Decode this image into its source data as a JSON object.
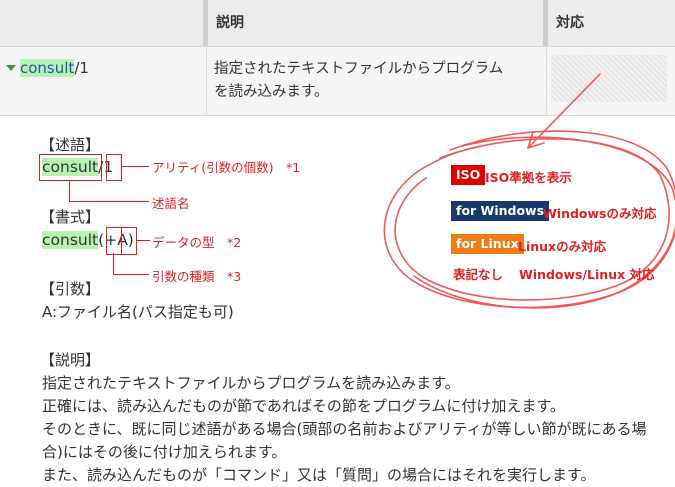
{
  "table": {
    "header_desc": "説明",
    "header_support": "対応",
    "row": {
      "predicate_name": "consult",
      "predicate_arity": "/1",
      "description_line1": "指定されたテキストファイルからプログラム",
      "description_line2": "を読み込みます。"
    }
  },
  "detail": {
    "predicate_heading": "【述語】",
    "predicate_name": "consult",
    "predicate_slash": "/",
    "predicate_arity": "1",
    "arity_note": "アリティ(引数の個数)　*1",
    "name_note": "述語名",
    "format_heading": "【書式】",
    "format_name": "consult",
    "format_open": "(",
    "format_type": "+",
    "format_arg": "A",
    "format_close": ")",
    "type_note": "データの型　*2",
    "kind_note": "引数の種類　*3",
    "args_heading": "【引数】",
    "args_text": "A:ファイル名(パス指定も可)",
    "desc_heading": "【説明】",
    "desc_lines": [
      "指定されたテキストファイルからプログラムを読み込みます。",
      "正確には、読み込んだものが節であればその節をプログラムに付け加えます。",
      "そのときに、既に同じ述語がある場合(頭部の名前およびアリティが等しい節が既にある場",
      "合)にはその後に付け加えられます。",
      "また、読み込んだものが「コマンド」又は「質問」の場合にはそれを実行します。"
    ]
  },
  "legend": {
    "iso_badge": "ISO",
    "iso_text": "ISO準拠を表示",
    "windows_badge": "for Windows",
    "windows_text": "Windowsのみ対応",
    "linux_badge": "for Linux",
    "linux_text": "Linuxのみ対応",
    "none_label": "表記なし",
    "none_text": "Windows/Linux 対応"
  },
  "colors": {
    "annotation_red": "#e02020",
    "highlight_green": "#b6f2b2",
    "iso_badge_bg": "#e00000",
    "windows_badge_bg": "#173a6b",
    "linux_badge_bg": "#f07a14",
    "header_bg": "#ececec",
    "row_bg": "#f5f5f5"
  }
}
